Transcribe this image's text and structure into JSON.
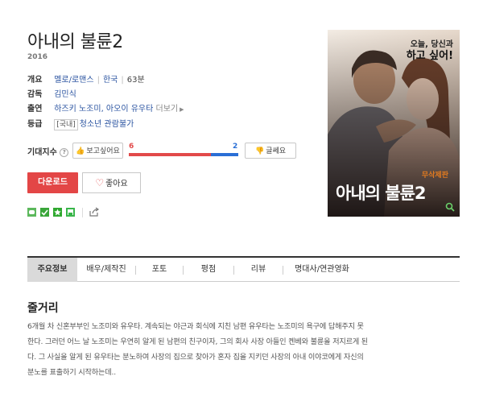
{
  "movie": {
    "title": "아내의 불륜2",
    "year": "2016"
  },
  "info": {
    "genre_label": "개요",
    "genre": "멜로/로맨스",
    "country": "한국",
    "runtime": "63분",
    "director_label": "감독",
    "director": "김민식",
    "cast_label": "출연",
    "cast": "하즈키 노조미, 아오이 유우타",
    "cast_more": "더보기",
    "rating_label": "등급",
    "rating_tag": "[국내]",
    "rating": "청소년 관람불가"
  },
  "expect": {
    "label": "기대지수",
    "like_label": "보고싶어요",
    "dislike_label": "글쎄요",
    "like_count": 6,
    "dislike_count": 2,
    "colors": {
      "like": "#e24a4a",
      "dislike": "#2a6fd6"
    }
  },
  "actions": {
    "download": "다운로드",
    "favorite": "좋아요"
  },
  "poster": {
    "tagline_line1": "오늘, 당신과",
    "tagline_line2": "하고 싶어!",
    "badge": "무삭제판",
    "title": "아내의 불륜2"
  },
  "tabs": [
    {
      "label": "주요정보",
      "active": true
    },
    {
      "label": "배우/제작진"
    },
    {
      "label": "포토"
    },
    {
      "label": "평점"
    },
    {
      "label": "리뷰"
    },
    {
      "label": "명대사/연관영화"
    }
  ],
  "synopsis": {
    "heading": "줄거리",
    "lines": [
      "6개월 차 신혼부부인 노조미와 유우타. 계속되는 야근과 회식에 지친 남편 유우타는 노조미의 욕구에 답해주지 못",
      "한다. 그러던 어느 날 노조미는 우연히 알게 된 남편의 친구이자, 그의 회사 사장 아들인 켄베와 불륜을 저지르게 된",
      "다. 그 사실을 알게 된 유우타는 분노하여 사장의 집으로 찾아가 혼자 집을 지키던 사장의 아내 이야코에게 자신의",
      "분노를 표출하기 시작하는데.."
    ]
  }
}
